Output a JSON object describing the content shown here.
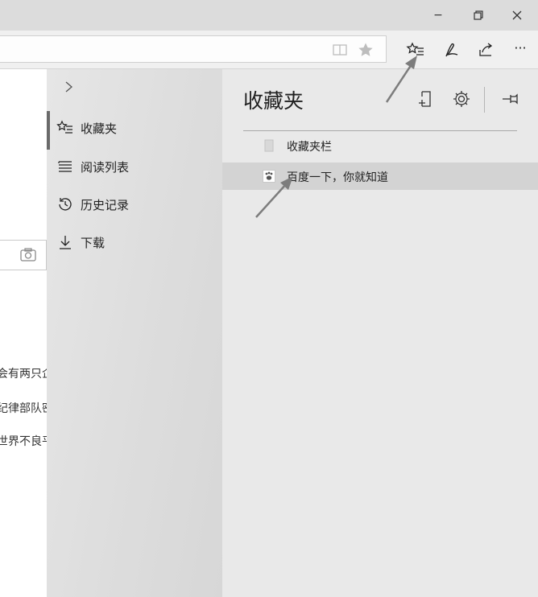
{
  "window": {
    "minimize_glyph": "−",
    "buttons": [
      "minimize",
      "restore",
      "close"
    ]
  },
  "toolbar": {
    "icons": [
      "reading-view-icon",
      "favorite-star-icon",
      "hub-favorites-icon",
      "web-note-icon",
      "share-icon",
      "more-icon"
    ],
    "more_label": "···"
  },
  "page": {
    "lines": [
      "会有两只企",
      "纪律部队密",
      "世界不良平"
    ]
  },
  "hub": {
    "collapse_glyph": ">",
    "items": [
      {
        "label": "收藏夹",
        "icon": "favorites-list-icon",
        "active": true
      },
      {
        "label": "阅读列表",
        "icon": "reading-list-icon",
        "active": false
      },
      {
        "label": "历史记录",
        "icon": "history-icon",
        "active": false
      },
      {
        "label": "下载",
        "icon": "download-icon",
        "active": false
      }
    ]
  },
  "favorites": {
    "title": "收藏夹",
    "tools": [
      "add-folder-icon",
      "settings-gear-icon",
      "pin-icon"
    ],
    "rows": [
      {
        "label": "收藏夹栏",
        "icon": "folder-icon",
        "selected": false
      },
      {
        "label": "百度一下，你就知道",
        "icon": "baidu-paw-icon",
        "selected": true
      }
    ]
  },
  "colors": {
    "titlebar": "#dcdcdc",
    "hub_nav": "#dddddd",
    "favorites_pane": "#e9e9e9",
    "selected_row": "#d3d3d3",
    "annotation_arrow": "#7d7d7d"
  }
}
